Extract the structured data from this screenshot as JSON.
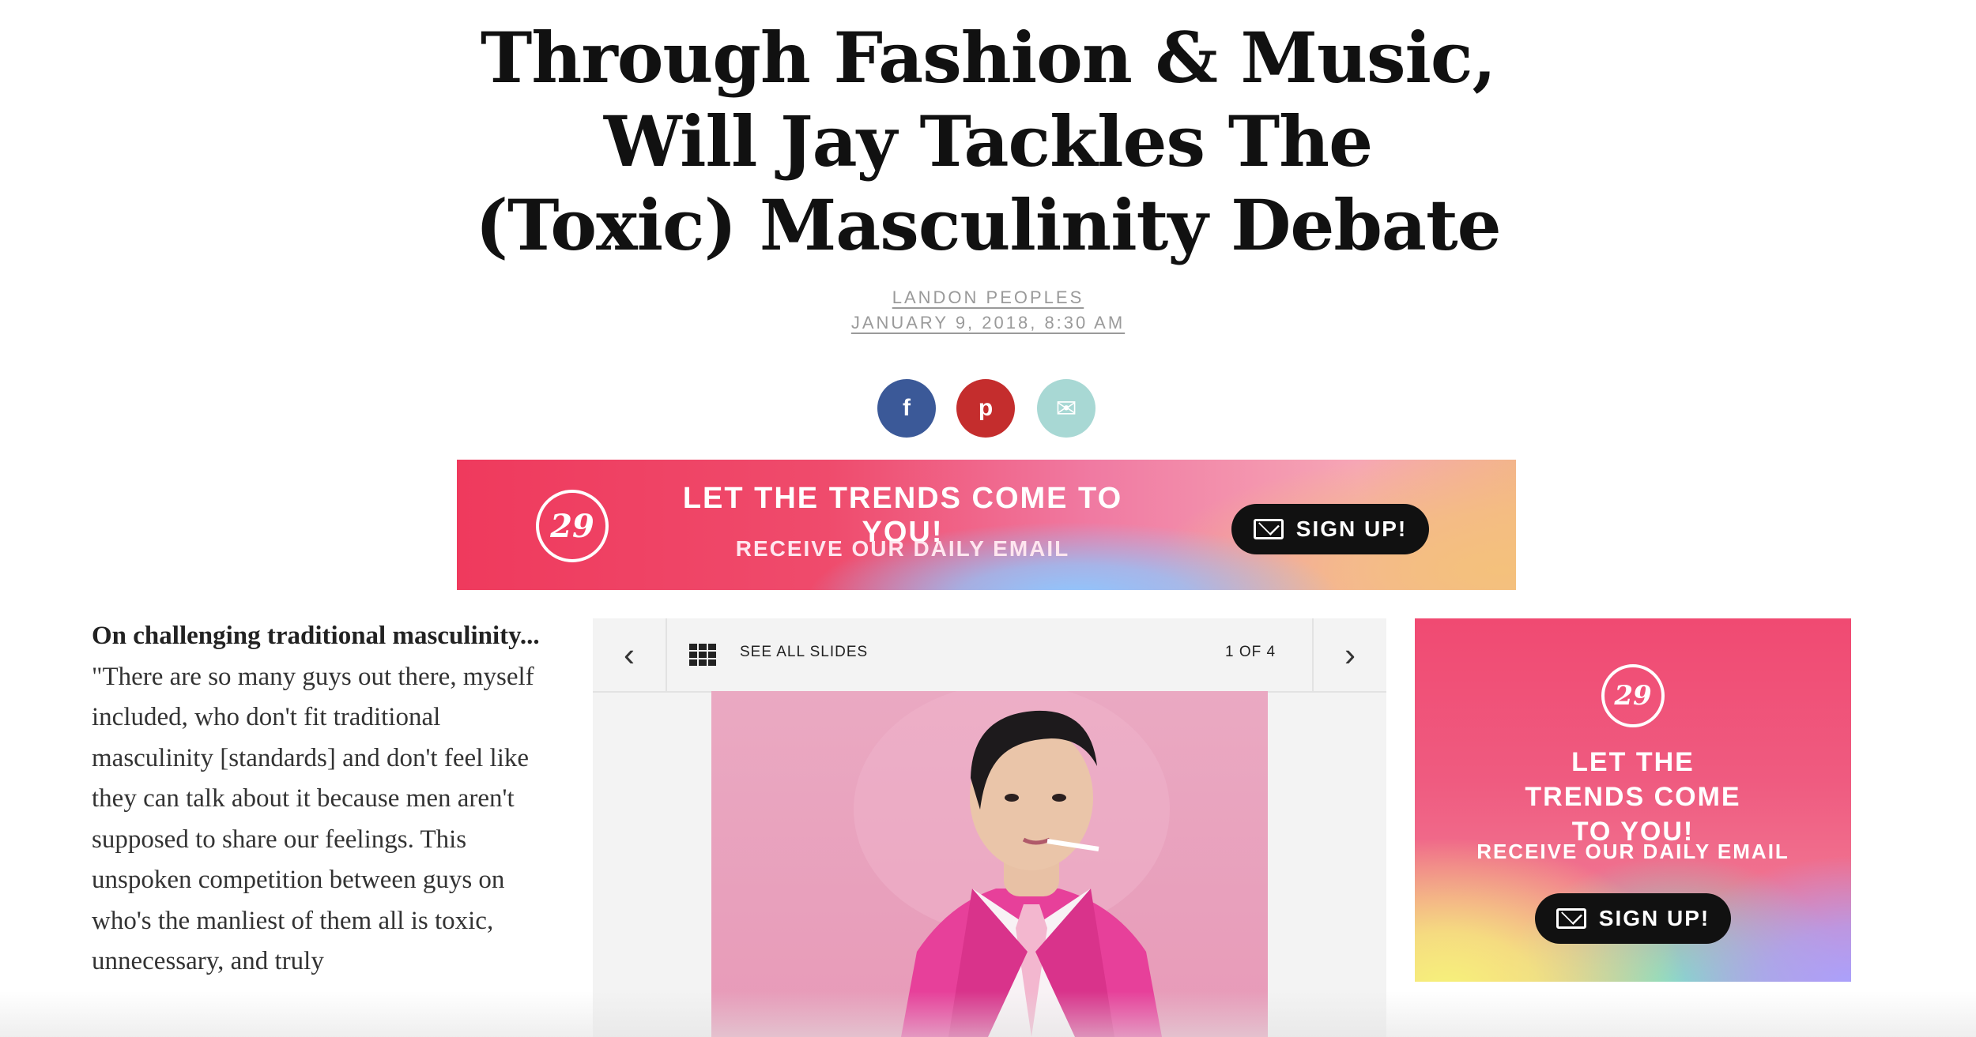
{
  "article": {
    "title": "Through Fashion & Music, Will Jay Tackles The (Toxic) Masculinity Debate",
    "author": "LANDON PEOPLES",
    "date": "JANUARY 9, 2018, 8:30 AM",
    "lead": "On challenging traditional masculinity...",
    "body": "\"There are so many guys out there, myself included, who don't fit traditional masculinity [standards] and don't feel like they can talk about it because men aren't supposed to share our feelings. This unspoken competition between guys on who's the manliest of them all is toxic, unnecessary, and truly"
  },
  "share": {
    "facebook_icon": "facebook-icon",
    "pinterest_icon": "pinterest-icon",
    "email_icon": "email-icon",
    "facebook_glyph": "f",
    "pinterest_glyph": "p",
    "email_glyph": "✉",
    "colors": {
      "facebook": "#3b5998",
      "pinterest": "#c42d2d",
      "email": "#a8d8d4"
    }
  },
  "banner_ad": {
    "logo": "29",
    "headline": "LET THE TRENDS COME TO YOU!",
    "subline": "RECEIVE OUR DAILY EMAIL",
    "button": "SIGN UP!"
  },
  "slideshow": {
    "see_all": "SEE ALL SLIDES",
    "counter": "1 OF 4",
    "prev_glyph": "‹",
    "next_glyph": "›"
  },
  "side_ad": {
    "logo": "29",
    "headline": "LET THE TRENDS COME TO YOU!",
    "subline": "RECEIVE OUR DAILY EMAIL",
    "button": "SIGN UP!"
  }
}
